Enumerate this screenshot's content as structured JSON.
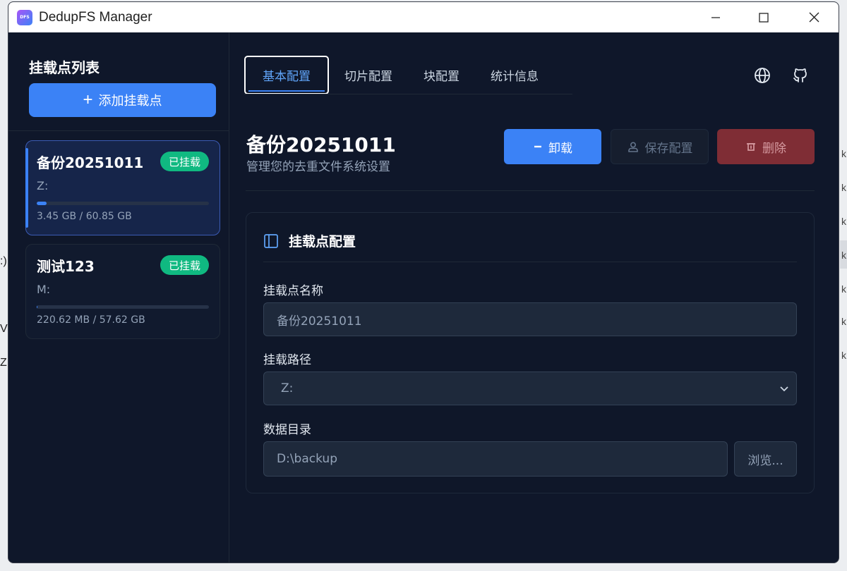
{
  "window": {
    "title": "DedupFS Manager",
    "app_icon_text": "DFS"
  },
  "background": {
    "frag_a": ":)",
    "frag_b": "V",
    "frag_c": "Z:",
    "right_letters": [
      "k",
      "k",
      "k",
      "k",
      "k",
      "k",
      "k"
    ]
  },
  "sidebar": {
    "title": "挂载点列表",
    "add_button": "添加挂载点",
    "mounts": [
      {
        "name": "备份20251011",
        "status": "已挂载",
        "drive": "Z:",
        "usage": "3.45 GB / 60.85 GB",
        "fill_percent": 5.7
      },
      {
        "name": "测试123",
        "status": "已挂载",
        "drive": "M:",
        "usage": "220.62 MB / 57.62 GB",
        "fill_percent": 0.4
      }
    ]
  },
  "tabs": [
    {
      "label": "基本配置",
      "active": true
    },
    {
      "label": "切片配置",
      "active": false
    },
    {
      "label": "块配置",
      "active": false
    },
    {
      "label": "统计信息",
      "active": false
    }
  ],
  "header": {
    "title": "备份20251011",
    "subtitle": "管理您的去重文件系统设置",
    "unmount_button": "卸载",
    "save_button": "保存配置",
    "delete_button": "删除"
  },
  "panel": {
    "title": "挂载点配置",
    "name_label": "挂载点名称",
    "name_value": "备份20251011",
    "path_label": "挂载路径",
    "path_value": "Z:",
    "dir_label": "数据目录",
    "dir_value": "D:\\backup",
    "browse_button": "浏览..."
  },
  "colors": {
    "accent": "#3b82f6",
    "success": "#10b981",
    "danger": "#7f2d35",
    "bg": "#0f172a"
  }
}
